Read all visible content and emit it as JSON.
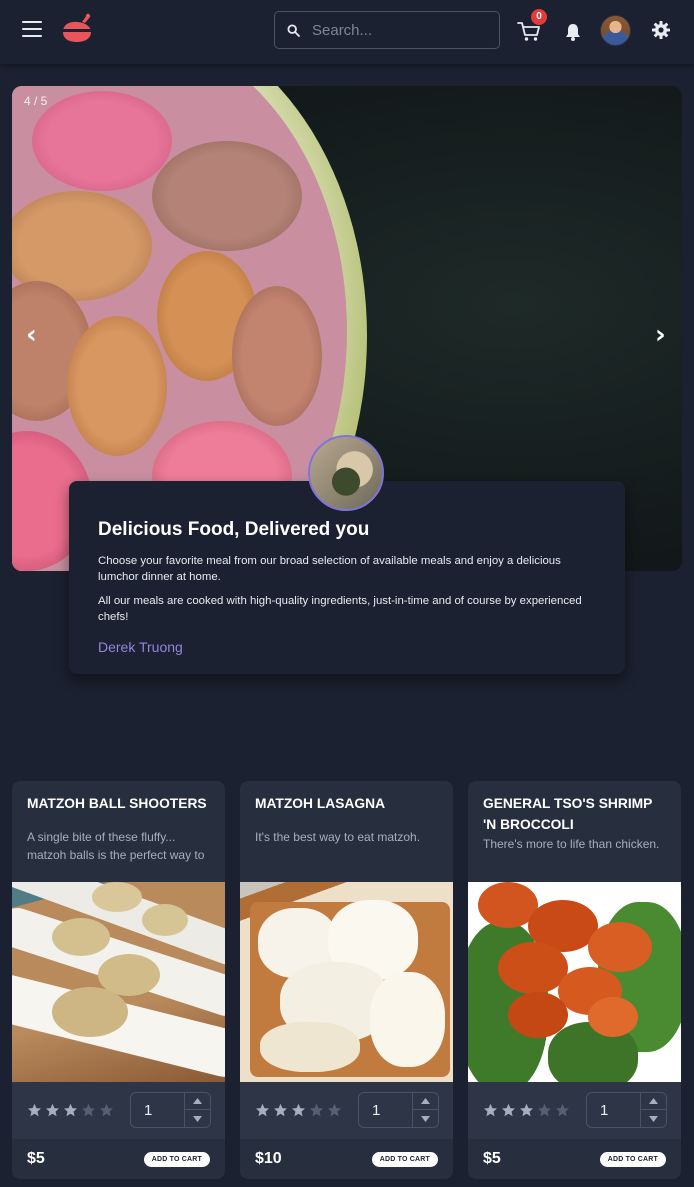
{
  "header": {
    "search_placeholder": "Search...",
    "cart_count": "0",
    "icons": [
      "menu-icon",
      "logo-icon",
      "search-icon",
      "cart-icon",
      "bell-icon",
      "avatar",
      "gear-icon"
    ],
    "accent_color": "#e8555a"
  },
  "carousel": {
    "counter": "4 / 5",
    "prev_label": "‹",
    "next_label": "›"
  },
  "testimonial": {
    "title": "Delicious Food, Delivered you",
    "paragraph1": "Choose your favorite meal from our broad selection of available meals and enjoy a delicious lumchor dinner at home.",
    "paragraph2": "All our meals are cooked with high-quality ingredients, just-in-time and of course by experienced chefs!",
    "author": "Derek Truong",
    "author_color": "#8f86e0"
  },
  "products": [
    {
      "title": "MATZOH BALL SHOOTERS",
      "description": "A single bite of these fluffy... matzoh balls is the perfect way to",
      "rating": 3,
      "max_rating": 5,
      "quantity": "1",
      "price": "$5",
      "button": "ADD TO CART"
    },
    {
      "title": "MATZOH LASAGNA",
      "description": "It's the best way to eat matzoh.",
      "rating": 3,
      "max_rating": 5,
      "quantity": "1",
      "price": "$10",
      "button": "ADD TO CART"
    },
    {
      "title": "GENERAL TSO'S SHRIMP 'N BROCCOLI",
      "description": "There's more to life than chicken.",
      "rating": 3,
      "max_rating": 5,
      "quantity": "1",
      "price": "$5",
      "button": "ADD TO CART"
    }
  ]
}
